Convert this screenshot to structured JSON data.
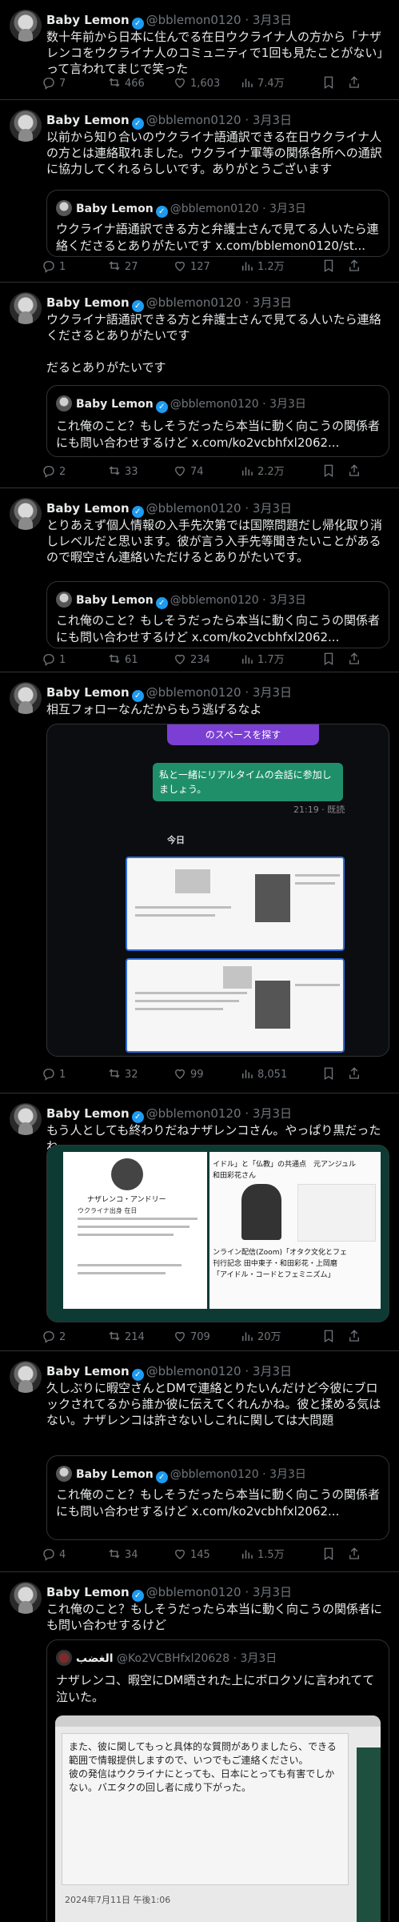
{
  "icons": {
    "reply": "reply-icon",
    "retweet": "retweet-icon",
    "like": "heart-icon",
    "views": "views-icon",
    "bookmark": "bookmark-icon",
    "share": "share-icon"
  },
  "colors": {
    "background": "#000000",
    "text": "#e7e9ea",
    "muted": "#71767b",
    "border": "#2f3336",
    "verified": "#1d9bf0"
  },
  "author": {
    "name": "Baby Lemon",
    "handle": "@bblemon0120",
    "date": "3月3日",
    "sep": "·"
  },
  "tweets": [
    {
      "text": "数十年前から日本に住んでる在日ウクライナ人の方から「ナザレンコをウクライナ人のコミュニティで1回も見たことがない」って言われてまじで笑った",
      "reply": "7",
      "retweet": "466",
      "like": "1,603",
      "views": "7.4万"
    },
    {
      "text": "以前から知り合いのウクライナ語通訳できる在日ウクライナ人の方とは連絡取れました。ウクライナ軍等の関係各所への通訳に協力してくれるらしいです。ありがとうございます",
      "quote": {
        "name": "Baby Lemon",
        "handle": "@bblemon0120",
        "date": "3月3日",
        "text": "ウクライナ語通訳できる方と弁護士さんで見てる人いたら連絡くださるとありがたいです x.com/bblemon0120/st..."
      },
      "reply": "1",
      "retweet": "27",
      "like": "127",
      "views": "1.2万"
    },
    {
      "text": "ウクライナ語通訳できる方と弁護士さんで見てる人いたら連絡くださるとありがたいです\n\nだるとありがたいです",
      "quote": {
        "name": "Baby Lemon",
        "handle": "@bblemon0120",
        "date": "3月3日",
        "text": "これ俺のこと？もしそうだったら本当に動く向こうの関係者にも問い合わせするけど x.com/ko2vcbhfxl2062..."
      },
      "reply": "2",
      "retweet": "33",
      "like": "74",
      "views": "2.2万"
    },
    {
      "text": "とりあえず個人情報の入手先次第では国際問題だし帰化取り消しレベルだと思います。彼が言う入手先等聞きたいことがあるので暇空さん連絡いただけるとありがたいです。",
      "quote": {
        "name": "Baby Lemon",
        "handle": "@bblemon0120",
        "date": "3月3日",
        "text": "これ俺のこと？もしそうだったら本当に動く向こうの関係者にも問い合わせするけど x.com/ko2vcbhfxl2062..."
      },
      "reply": "1",
      "retweet": "61",
      "like": "234",
      "views": "1.7万"
    },
    {
      "text": "相互フォローなんだからもう逃げるなよ",
      "media": {
        "top_banner": "のスペースを探す",
        "bubble": "私と一緒にリアルタイムの会話に参加しましょう。",
        "time": "21:19 · 既読",
        "today": "今日"
      },
      "reply": "1",
      "retweet": "32",
      "like": "99",
      "views": "8,051"
    },
    {
      "text": "もう人としても終わりだねナザレンコさん。やっぱり黒だったね",
      "media": {
        "profile_name": "ナザレンコ・アンドリー",
        "left_caption": "ウクライナ出身 在日",
        "headline1": "イドル」と「仏教」の共通点　元アンジュル",
        "headline2": "和田彩花さん",
        "headline3": "ンライン配信(Zoom)「オタク文化とフェ",
        "headline4": "刊行記念 田中東子・和田彩花・上岡磨",
        "headline5": "「アイドル・コードとフェミニズム」"
      },
      "reply": "2",
      "retweet": "214",
      "like": "709",
      "views": "20万"
    },
    {
      "text": "久しぶりに暇空さんとDMで連絡とりたいんだけど今彼にブロックされてるから誰か彼に伝えてくれんかね。彼と揉める気はない。ナザレンコは許さないしこれに関しては大問題",
      "quote": {
        "name": "Baby Lemon",
        "handle": "@bblemon0120",
        "date": "3月3日",
        "text": "これ俺のこと？もしそうだったら本当に動く向こうの関係者にも問い合わせするけど x.com/ko2vcbhfxl2062..."
      },
      "reply": "4",
      "retweet": "34",
      "like": "145",
      "views": "1.5万"
    },
    {
      "text": "これ俺のこと？もしそうだったら本当に動く向こうの関係者にも問い合わせするけど",
      "quote": {
        "name": "الغضب",
        "handle": "@Ko2VCBHfxl20628",
        "date": "3月3日",
        "text": "ナザレンコ、暇空にDM晒された上にボロクソに言われてて泣いた。"
      },
      "media": {
        "dm_text": "また、彼に関してもっと具体的な質問がありましたら、できる範囲で情報提供しますので、いつでもご連絡ください。\n彼の発信はウクライナにとっても、日本にとっても有害でしかない。バエタクの回し者に成り下がった。",
        "dm_date": "2024年7月11日 午後1:06"
      }
    }
  ]
}
